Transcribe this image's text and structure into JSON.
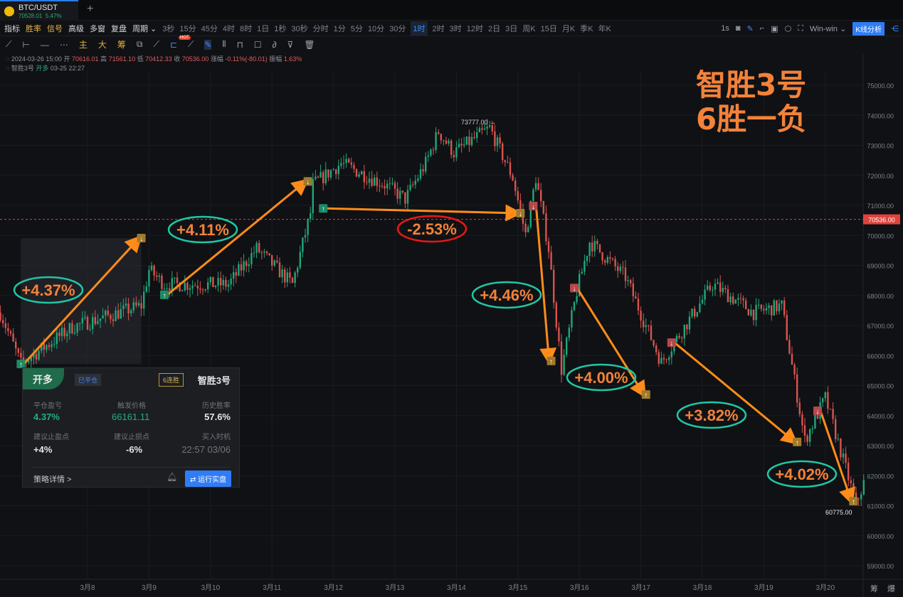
{
  "tab": {
    "symbol": "BTC/USDT",
    "price": "70528.01",
    "change": "5.47%"
  },
  "toolbar": {
    "main": [
      {
        "label": "指标",
        "icon": "indicator-icon"
      },
      {
        "label": "胜率",
        "icon": "winrate-icon",
        "gold": true
      },
      {
        "label": "信号",
        "icon": "signal-icon",
        "gold": true
      },
      {
        "label": "高级",
        "icon": "advanced-icon"
      },
      {
        "label": "多窗",
        "icon": "multiwindow-icon"
      },
      {
        "label": "复盘",
        "icon": "replay-icon"
      },
      {
        "label": "周期 ⌄",
        "icon": ""
      }
    ],
    "periods": [
      "3秒",
      "15分",
      "45分",
      "4时",
      "8时",
      "1日",
      "1秒",
      "30秒",
      "分时",
      "1分",
      "5分",
      "10分",
      "30分",
      "1时",
      "2时",
      "3时",
      "12时",
      "2日",
      "3日",
      "周K",
      "15日",
      "月K",
      "季K",
      "年K"
    ],
    "active_period": "1时",
    "right": {
      "interval": "1s",
      "theme": "Win-win ⌄",
      "analysis": "K线分析"
    }
  },
  "drawing_tools": {
    "labels": [
      "主",
      "大",
      "筹"
    ],
    "hot_badge": "HOT"
  },
  "ohlc": {
    "date": "2024-03-26 15:00",
    "open_label": "开",
    "open": "70616.01",
    "high_label": "高",
    "high": "71561.10",
    "low_label": "低",
    "low": "70412.33",
    "close_label": "收",
    "close": "70536.00",
    "change_label": "涨幅",
    "change": "-0.11%(-80.01)",
    "amp_label": "振幅",
    "amp": "1.63%"
  },
  "strategy_line": {
    "name": "智胜3号",
    "action": "开多",
    "time": "03-25 22:27"
  },
  "headline": {
    "line1": "智胜3号",
    "line2": "6胜一负"
  },
  "panel": {
    "side": "开多",
    "status": "已平仓",
    "streak": "6连胜",
    "name": "智胜3号",
    "fields": [
      {
        "label": "平仓盈亏",
        "value": "4.37%"
      },
      {
        "label": "触发价格",
        "value": "66161.11"
      },
      {
        "label": "历史胜率",
        "value": "57.6%"
      },
      {
        "label": "建议止盈点",
        "value": "+4%"
      },
      {
        "label": "建议止损点",
        "value": "-6%"
      },
      {
        "label": "买入时机",
        "value": "22:57 03/06"
      }
    ],
    "details": "策略详情 >",
    "run": "⇄ 运行实盘"
  },
  "corner": "筹 爆",
  "chart_data": {
    "type": "candlestick",
    "symbol": "BTC/USDT",
    "interval": "1时",
    "ylim": [
      58700,
      75600
    ],
    "y_ticks": [
      59000,
      60000,
      61000,
      62000,
      63000,
      64000,
      65000,
      66000,
      67000,
      68000,
      69000,
      70000,
      71000,
      72000,
      73000,
      74000,
      75000
    ],
    "x_ticks": [
      "3月8",
      "3月9",
      "3月10",
      "3月11",
      "3月12",
      "3月13",
      "3月14",
      "3月15",
      "3月16",
      "3月17",
      "3月18",
      "3月19",
      "3月20"
    ],
    "current_price": "70536.00",
    "high_label": "73777.00 →",
    "low_label": "60775.00",
    "colors": {
      "up": "#1fa77a",
      "down": "#d9534f",
      "trade_arrow": "#ff8c1a",
      "win_oval": "#1fc7a6",
      "loss_oval": "#e81818",
      "label": "#f3823a",
      "current_line": "#e0433c"
    },
    "price_path": [
      [
        "03-06 14:00",
        67430
      ],
      [
        "03-06 22:00",
        65720
      ],
      [
        "03-07 18:00",
        66950
      ],
      [
        "03-08 21:00",
        67660
      ],
      [
        "03-09 00:00",
        68850
      ],
      [
        "03-09 06:00",
        68370
      ],
      [
        "03-10 07:00",
        68370
      ],
      [
        "03-10 18:00",
        69560
      ],
      [
        "03-11 08:00",
        68370
      ],
      [
        "03-11 15:00",
        70740
      ],
      [
        "03-11 16:00",
        71690
      ],
      [
        "03-12 03:00",
        72400
      ],
      [
        "03-12 20:00",
        71690
      ],
      [
        "03-13 04:00",
        71210
      ],
      [
        "03-13 12:00",
        72400
      ],
      [
        "03-13 17:00",
        73460
      ],
      [
        "03-13 23:00",
        72750
      ],
      [
        "03-14 13:00",
        73580
      ],
      [
        "03-14 22:00",
        71920
      ],
      [
        "03-15 03:00",
        70030
      ],
      [
        "03-15 07:00",
        71920
      ],
      [
        "03-15 12:00",
        69560
      ],
      [
        "03-15 17:00",
        65530
      ],
      [
        "03-15 23:00",
        68140
      ],
      [
        "03-16 04:00",
        69790
      ],
      [
        "03-16 18:00",
        68610
      ],
      [
        "03-17 08:00",
        65770
      ],
      [
        "03-17 17:00",
        66950
      ],
      [
        "03-18 04:00",
        68370
      ],
      [
        "03-18 20:00",
        67430
      ],
      [
        "03-19 07:00",
        67660
      ],
      [
        "03-19 16:00",
        63170
      ],
      [
        "03-20 00:00",
        64590
      ],
      [
        "03-20 12:00",
        61040
      ],
      [
        "03-20 15:00",
        61750
      ]
    ],
    "trades": [
      {
        "side": "long",
        "entry": [
          "03-06 22:00",
          65720
        ],
        "exit": [
          "03-08 21:00",
          69910
        ],
        "result": "+4.37%",
        "win": true
      },
      {
        "side": "long",
        "entry": [
          "03-09 06:00",
          68020
        ],
        "exit": [
          "03-11 14:00",
          71800
        ],
        "result": "+4.11%",
        "win": true
      },
      {
        "side": "long",
        "entry": [
          "03-11 20:00",
          70900
        ],
        "exit": [
          "03-15 01:00",
          70740
        ],
        "result": "-2.53%",
        "win": false
      },
      {
        "side": "short",
        "entry": [
          "03-15 06:00",
          70980
        ],
        "exit": [
          "03-15 13:00",
          65820
        ],
        "result": "+4.46%",
        "win": true
      },
      {
        "side": "short",
        "entry": [
          "03-15 22:00",
          68250
        ],
        "exit": [
          "03-17 02:00",
          64700
        ],
        "result": "+4.00%",
        "win": true
      },
      {
        "side": "short",
        "entry": [
          "03-17 12:00",
          66430
        ],
        "exit": [
          "03-19 13:00",
          63120
        ],
        "result": "+3.82%",
        "win": true
      },
      {
        "side": "short",
        "entry": [
          "03-19 21:00",
          64160
        ],
        "exit": [
          "03-20 11:00",
          61150
        ],
        "result": "+4.02%",
        "win": true
      }
    ]
  }
}
